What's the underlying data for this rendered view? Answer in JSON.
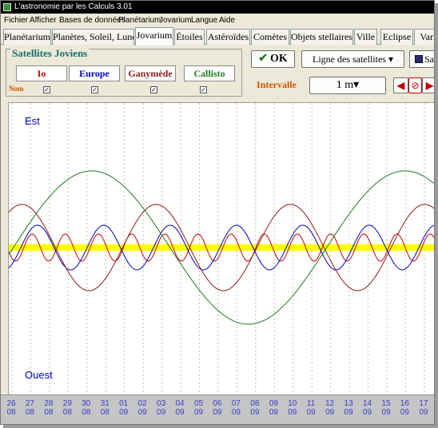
{
  "window": {
    "title": "L'astronomie par les Calculs 3.01"
  },
  "menu": [
    "Fichier",
    "Afficher",
    "Bases de données",
    "Planétarium",
    "Jovarium",
    "Langue",
    "Aide"
  ],
  "tabs": [
    {
      "label": "Planétarium",
      "active": false
    },
    {
      "label": "Planètes, Soleil, Lune",
      "active": false
    },
    {
      "label": "Jovarium",
      "active": true
    },
    {
      "label": "Étoiles",
      "active": false
    },
    {
      "label": "Astéroïdes",
      "active": false
    },
    {
      "label": "Comètes",
      "active": false
    },
    {
      "label": "Objets stellaires",
      "active": false
    },
    {
      "label": "Ville",
      "active": false
    },
    {
      "label": "Eclipse",
      "active": false
    },
    {
      "label": "Varia",
      "active": false
    }
  ],
  "satellites_panel": {
    "title": "Satellites Joviens",
    "nom_label": "Nom",
    "satellites": [
      {
        "name": "Io",
        "color": "#c80000",
        "show_name": true
      },
      {
        "name": "Europe",
        "color": "#0000c8",
        "show_name": true
      },
      {
        "name": "Ganymède",
        "color": "#8b1a1a",
        "show_name": true
      },
      {
        "name": "Callisto",
        "color": "#1e7c1e",
        "show_name": true
      }
    ]
  },
  "toolbar": {
    "ok_label": "OK",
    "ok_icon": "check-icon",
    "lines_label": "Ligne des satellites",
    "lines_arrow": "▾",
    "save_label": "Sa",
    "save_icon": "floppy-icon",
    "interval_label": "Intervalle",
    "interval_value": "1 m",
    "interval_arrow": "▾",
    "back_glyph": "◀",
    "stop_glyph": "⊘",
    "forward_glyph": "▶"
  },
  "plot": {
    "top_label": "Est",
    "bottom_label": "Ouest",
    "center_band_color": "#ffff00",
    "gridlines": "vertical dashed",
    "dates": [
      {
        "day": "26",
        "month": "08"
      },
      {
        "day": "27",
        "month": "08"
      },
      {
        "day": "28",
        "month": "08"
      },
      {
        "day": "29",
        "month": "08"
      },
      {
        "day": "30",
        "month": "08"
      },
      {
        "day": "31",
        "month": "08"
      },
      {
        "day": "01",
        "month": "09"
      },
      {
        "day": "02",
        "month": "09"
      },
      {
        "day": "03",
        "month": "09"
      },
      {
        "day": "04",
        "month": "09"
      },
      {
        "day": "05",
        "month": "09"
      },
      {
        "day": "06",
        "month": "09"
      },
      {
        "day": "07",
        "month": "09"
      },
      {
        "day": "08",
        "month": "09"
      },
      {
        "day": "09",
        "month": "09"
      },
      {
        "day": "10",
        "month": "09"
      },
      {
        "day": "11",
        "month": "09"
      },
      {
        "day": "12",
        "month": "09"
      },
      {
        "day": "13",
        "month": "09"
      },
      {
        "day": "14",
        "month": "09"
      },
      {
        "day": "15",
        "month": "09"
      },
      {
        "day": "16",
        "month": "09"
      },
      {
        "day": "17",
        "month": "09"
      }
    ]
  }
}
